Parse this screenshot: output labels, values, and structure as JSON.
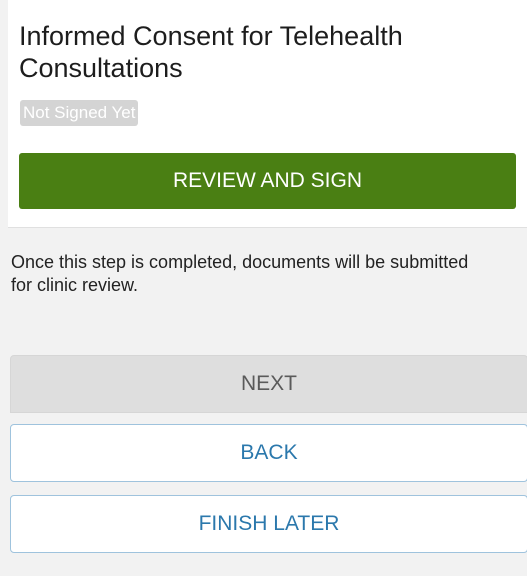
{
  "document": {
    "title": "Informed Consent for Telehealth Consultations",
    "status": "Not Signed Yet",
    "action_label": "REVIEW AND SIGN"
  },
  "note": "Once this step is completed, documents will be submitted for clinic review.",
  "buttons": {
    "next": "NEXT",
    "back": "BACK",
    "finish_later": "FINISH LATER"
  },
  "colors": {
    "primary_green": "#4a7f13",
    "link_blue": "#2b78ac",
    "badge_gray": "#d4d4d4"
  }
}
